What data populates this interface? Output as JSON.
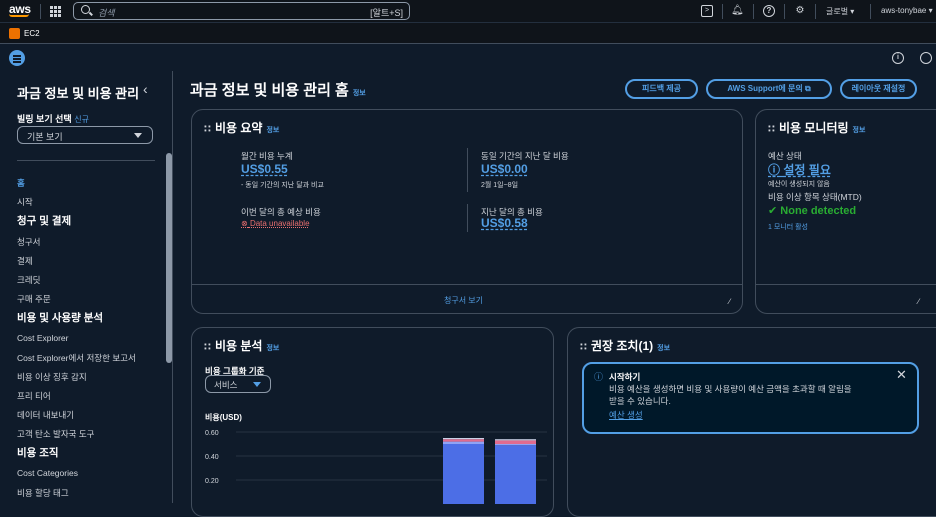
{
  "topnav": {
    "logo": "aws",
    "search_placeholder": "검색",
    "search_shortcut": "[알트+S]",
    "region": "글로벌 ▾",
    "account": "aws-tonybae ▾"
  },
  "service": {
    "name": "EC2"
  },
  "sidebar": {
    "title": "과금 정보 및 비용 관리",
    "view_label": "빌링 보기 선택",
    "view_new": "신규",
    "view_value": "기본 보기",
    "items": [
      {
        "label": "홈",
        "type": "active"
      },
      {
        "label": "시작",
        "type": "item"
      },
      {
        "label": "청구 및 결제",
        "type": "head"
      },
      {
        "label": "청구서",
        "type": "item"
      },
      {
        "label": "결제",
        "type": "item"
      },
      {
        "label": "크레딧",
        "type": "item"
      },
      {
        "label": "구매 주문",
        "type": "item"
      },
      {
        "label": "비용 및 사용량 분석",
        "type": "head"
      },
      {
        "label": "Cost Explorer",
        "type": "item"
      },
      {
        "label": "Cost Explorer에서 저장한 보고서",
        "type": "item"
      },
      {
        "label": "비용 이상 징후 감지",
        "type": "item"
      },
      {
        "label": "프리 티어",
        "type": "item"
      },
      {
        "label": "데이터 내보내기",
        "type": "item"
      },
      {
        "label": "고객 탄소 발자국 도구",
        "type": "item"
      },
      {
        "label": "비용 조직",
        "type": "head"
      },
      {
        "label": "Cost Categories",
        "type": "item"
      },
      {
        "label": "비용 할당 태그",
        "type": "item"
      }
    ]
  },
  "header": {
    "title": "과금 정보 및 비용 관리 홈",
    "info": "정보",
    "feedback_btn": "피드백 제공",
    "support_btn": "AWS Support에 문의",
    "layout_btn": "레이아웃 재설정"
  },
  "summary": {
    "title": "비용 요약",
    "info": "정보",
    "mtd_label": "월간 비용 누계",
    "mtd_value": "US$0.55",
    "mtd_sub": "- 동일 기간의 지난 달과 비교",
    "prev_label": "동일 기간의 지난 달 비용",
    "prev_value": "US$0.00",
    "prev_sub": "2월 1일~8일",
    "forecast_label": "이번 달의 총 예상 비용",
    "forecast_value": "Data unavailable",
    "last_label": "지난 달의 총 비용",
    "last_value": "US$0.58",
    "footer_link": "청구서 보기"
  },
  "monitoring": {
    "title": "비용 모니터링",
    "info": "정보",
    "budget_label": "예산 상태",
    "budget_value": "설정 필요",
    "budget_sub": "예산이 생성되지 않음",
    "anomaly_label": "비용 이상 항목 상태(MTD)",
    "anomaly_value": "None detected",
    "anomaly_sub": "1 모니터 활성"
  },
  "analysis": {
    "title": "비용 분석",
    "info": "정보",
    "group_label": "비용 그룹화 기준",
    "group_value": "서비스",
    "chart_title": "비용(USD)"
  },
  "chart_data": {
    "type": "bar",
    "ylabel": "비용(USD)",
    "yticks": [
      "0.60",
      "0.40",
      "0.20"
    ],
    "ylim": [
      0,
      0.6
    ],
    "series": [
      {
        "color": "#4c6ee6",
        "values": [
          0.5,
          0.49
        ]
      },
      {
        "color": "#8fa3f5",
        "values": [
          0.02,
          0.01
        ]
      },
      {
        "color": "#e06b8f",
        "values": [
          0.02,
          0.03
        ]
      },
      {
        "color": "#c9d1e6",
        "values": [
          0.01,
          0.01
        ]
      }
    ]
  },
  "recommend": {
    "title": "권장 조치(1)",
    "info": "정보",
    "alert_title": "시작하기",
    "alert_body1": "비용 예산을 생성하면 비용 및 사용량이 예산 금액을 초과할 때 알림을",
    "alert_body2": "받을 수 있습니다.",
    "alert_link": "예산 생성"
  }
}
